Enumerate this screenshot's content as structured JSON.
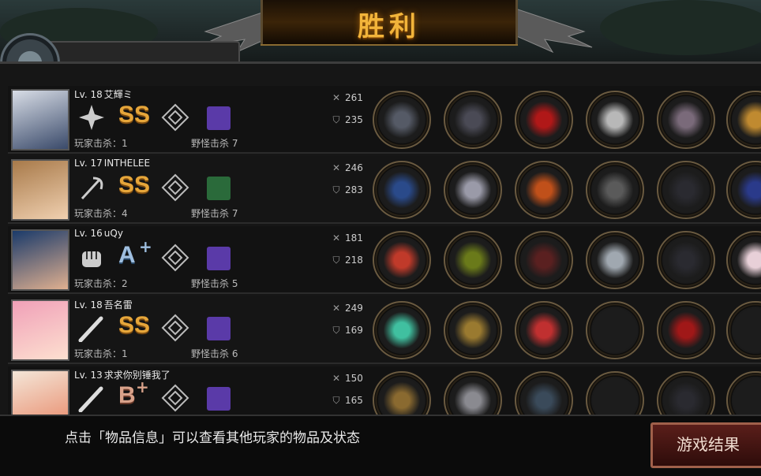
{
  "header": {
    "title": "胜利"
  },
  "players": [
    {
      "level": "Lv. 18",
      "name": "艾輝ミ",
      "grade": "SS",
      "grade_style": "gold",
      "weapon_icon": "shuriken-icon",
      "player_kills_label": "玩家击杀：1",
      "monster_kills_label": "野怪击杀 7",
      "atk": "261",
      "def": "235",
      "portrait_colors": [
        "#d8dde6",
        "#3a4a6a"
      ],
      "skill_color": "#5a3aa8",
      "items": [
        "boomerang-icon",
        "helmet-icon",
        "red-cape-icon",
        "silver-shield-icon",
        "boots-icon",
        "amulet-icon"
      ]
    },
    {
      "level": "Lv. 17",
      "name": "INTHELEE",
      "grade": "SS",
      "grade_style": "gold",
      "weapon_icon": "scythe-icon",
      "player_kills_label": "玩家击杀：4",
      "monster_kills_label": "野怪击杀 7",
      "atk": "246",
      "def": "283",
      "portrait_colors": [
        "#a87a4a",
        "#f0d0b0"
      ],
      "skill_color": "#2a6a3a",
      "items": [
        "blue-spear-icon",
        "mech-helmet-icon",
        "fire-armor-icon",
        "laptop-icon",
        "gauntlet-icon",
        "galaxy-orb-icon"
      ]
    },
    {
      "level": "Lv. 16",
      "name": "uQy",
      "grade": "A",
      "grade_style": "blue",
      "weapon_icon": "fist-icon",
      "player_kills_label": "玩家击杀：2",
      "monster_kills_label": "野怪击杀 5",
      "atk": "181",
      "def": "218",
      "portrait_colors": [
        "#1a3a6a",
        "#e0b090"
      ],
      "skill_color": "#5a3aa8",
      "items": [
        "red-glove-icon",
        "laurel-wreath-icon",
        "dark-armor-icon",
        "drill-icon",
        "gauntlet-icon",
        "pearl-icon"
      ]
    },
    {
      "level": "Lv. 18",
      "name": "吾名雷",
      "grade": "SS",
      "grade_style": "gold",
      "weapon_icon": "bat-icon",
      "player_kills_label": "玩家击杀：1",
      "monster_kills_label": "野怪击杀 6",
      "atk": "249",
      "def": "169",
      "portrait_colors": [
        "#f0a0b8",
        "#fde0d0"
      ],
      "skill_color": "#5a3aa8",
      "items": [
        "twin-blades-icon",
        "gold-helmet-icon",
        "red-jacket-icon",
        "empty-slot",
        "red-heels-icon",
        "empty-slot"
      ]
    },
    {
      "level": "Lv. 13",
      "name": "求求你别锤我了",
      "grade": "B",
      "grade_style": "peach",
      "weapon_icon": "bat-icon",
      "player_kills_label": "",
      "monster_kills_label": "",
      "atk": "150",
      "def": "165",
      "portrait_colors": [
        "#f4e6d8",
        "#e88a6a"
      ],
      "skill_color": "#5a3aa8",
      "items": [
        "whip-icon",
        "knight-helmet-icon",
        "plate-armor-icon",
        "empty-slot",
        "gauntlet-icon",
        "empty-slot"
      ]
    }
  ],
  "footer": {
    "tip": "点击「物品信息」可以查看其他玩家的物品及状态",
    "result_button": "游戏结果"
  }
}
